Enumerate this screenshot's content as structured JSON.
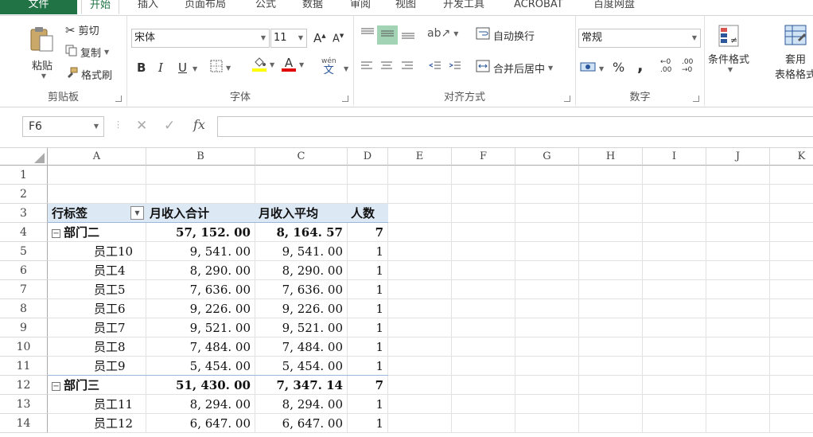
{
  "tabs": [
    "文件",
    "开始",
    "插入",
    "页面布局",
    "公式",
    "数据",
    "审阅",
    "视图",
    "开发工具",
    "ACROBAT",
    "百度网盘"
  ],
  "clipboard": {
    "paste": "粘贴",
    "cut": "剪切",
    "copy": "复制",
    "format_painter": "格式刷",
    "label": "剪贴板"
  },
  "font": {
    "name": "宋体",
    "size": "11",
    "bold": "B",
    "italic": "I",
    "underline": "U",
    "label": "字体",
    "wen": "wén",
    "wen_char": "文"
  },
  "alignment": {
    "wrap": "自动换行",
    "merge": "合并后居中",
    "label": "对齐方式"
  },
  "number": {
    "format": "常规",
    "percent": "%",
    "comma": ",",
    "inc": "←0 .00",
    "dec": ".00 →0",
    "label": "数字"
  },
  "styles": {
    "conditional": "条件格式",
    "table": "套用",
    "table2": "表格格式"
  },
  "formula_bar": {
    "name_box": "F6",
    "fx": "fx",
    "value": ""
  },
  "columns": [
    "A",
    "B",
    "C",
    "D",
    "E",
    "F",
    "G",
    "H",
    "I",
    "J",
    "K"
  ],
  "rows": [
    "1",
    "2",
    "3",
    "4",
    "5",
    "6",
    "7",
    "8",
    "9",
    "10",
    "11",
    "12",
    "13",
    "14"
  ],
  "pivot": {
    "headers": [
      "行标签",
      "月收入合计",
      "月收入平均",
      "人数"
    ],
    "groups": [
      {
        "name": "部门二",
        "sum": "57, 152. 00",
        "avg": "8, 164. 57",
        "count": "7",
        "items": [
          {
            "name": "员工10",
            "sum": "9, 541. 00",
            "avg": "9, 541. 00",
            "count": "1"
          },
          {
            "name": "员工4",
            "sum": "8, 290. 00",
            "avg": "8, 290. 00",
            "count": "1"
          },
          {
            "name": "员工5",
            "sum": "7, 636. 00",
            "avg": "7, 636. 00",
            "count": "1"
          },
          {
            "name": "员工6",
            "sum": "9, 226. 00",
            "avg": "9, 226. 00",
            "count": "1"
          },
          {
            "name": "员工7",
            "sum": "9, 521. 00",
            "avg": "9, 521. 00",
            "count": "1"
          },
          {
            "name": "员工8",
            "sum": "7, 484. 00",
            "avg": "7, 484. 00",
            "count": "1"
          },
          {
            "name": "员工9",
            "sum": "5, 454. 00",
            "avg": "5, 454. 00",
            "count": "1"
          }
        ]
      },
      {
        "name": "部门三",
        "sum": "51, 430. 00",
        "avg": "7, 347. 14",
        "count": "7",
        "items": [
          {
            "name": "员工11",
            "sum": "8, 294. 00",
            "avg": "8, 294. 00",
            "count": "1"
          },
          {
            "name": "员工12",
            "sum": "6, 647. 00",
            "avg": "6, 647. 00",
            "count": "1"
          }
        ]
      }
    ]
  },
  "colors": {
    "accent": "#217346",
    "pivot_header": "#dde8f5"
  }
}
